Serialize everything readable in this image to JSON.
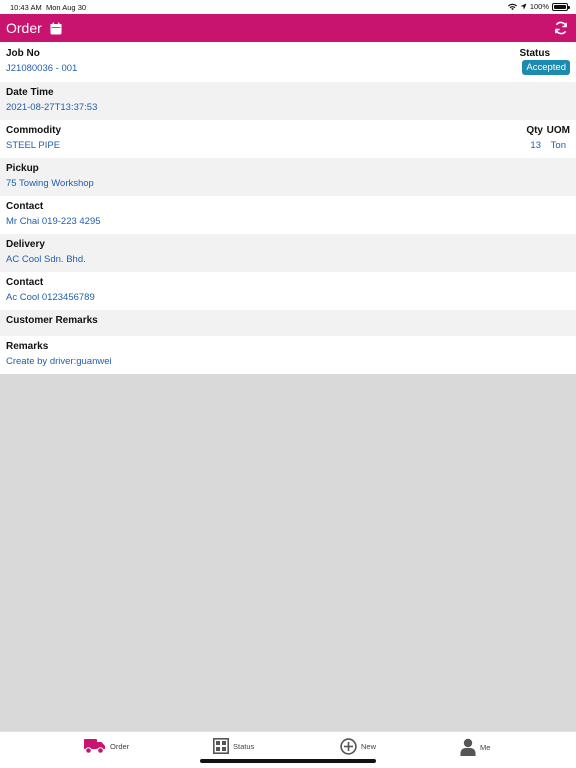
{
  "status_bar": {
    "time": "10:43 AM",
    "date": "Mon Aug 30",
    "battery": "100%",
    "icons": [
      "wifi-icon",
      "location-icon",
      "battery-icon"
    ]
  },
  "header": {
    "title": "Order",
    "icons": [
      "calendar-icon",
      "refresh-icon"
    ],
    "background": "#c8136f"
  },
  "job": {
    "label": "Job No",
    "value": "J21080036 - 001",
    "status_label": "Status",
    "status_value": "Accepted",
    "status_color": "#1d8ab0"
  },
  "datetime": {
    "label": "Date Time",
    "value": "2021-08-27T13:37:53"
  },
  "commodity": {
    "label": "Commodity",
    "value": "STEEL PIPE",
    "qty_label": "Qty",
    "qty_value": "13",
    "uom_label": "UOM",
    "uom_value": "Ton"
  },
  "pickup": {
    "label": "Pickup",
    "value": "75 Towing Workshop"
  },
  "pickup_contact": {
    "label": "Contact",
    "value": "Mr Chai 019-223 4295"
  },
  "delivery": {
    "label": "Delivery",
    "value": "AC Cool Sdn. Bhd."
  },
  "delivery_contact": {
    "label": "Contact",
    "value": "Ac Cool 0123456789"
  },
  "customer_remarks": {
    "label": "Customer Remarks"
  },
  "remarks": {
    "label": "Remarks",
    "value": "Create by driver:guanwei"
  },
  "tabs": [
    {
      "label": "Order",
      "icon": "truck-icon",
      "active": true,
      "color": "#c8136f"
    },
    {
      "label": "Status",
      "icon": "grid-icon",
      "active": false
    },
    {
      "label": "New",
      "icon": "plus-circle-icon",
      "active": false
    },
    {
      "label": "Me",
      "icon": "person-icon",
      "active": false
    }
  ],
  "colors": {
    "link": "#1f5fae",
    "page_background": "#d9d9d9"
  }
}
